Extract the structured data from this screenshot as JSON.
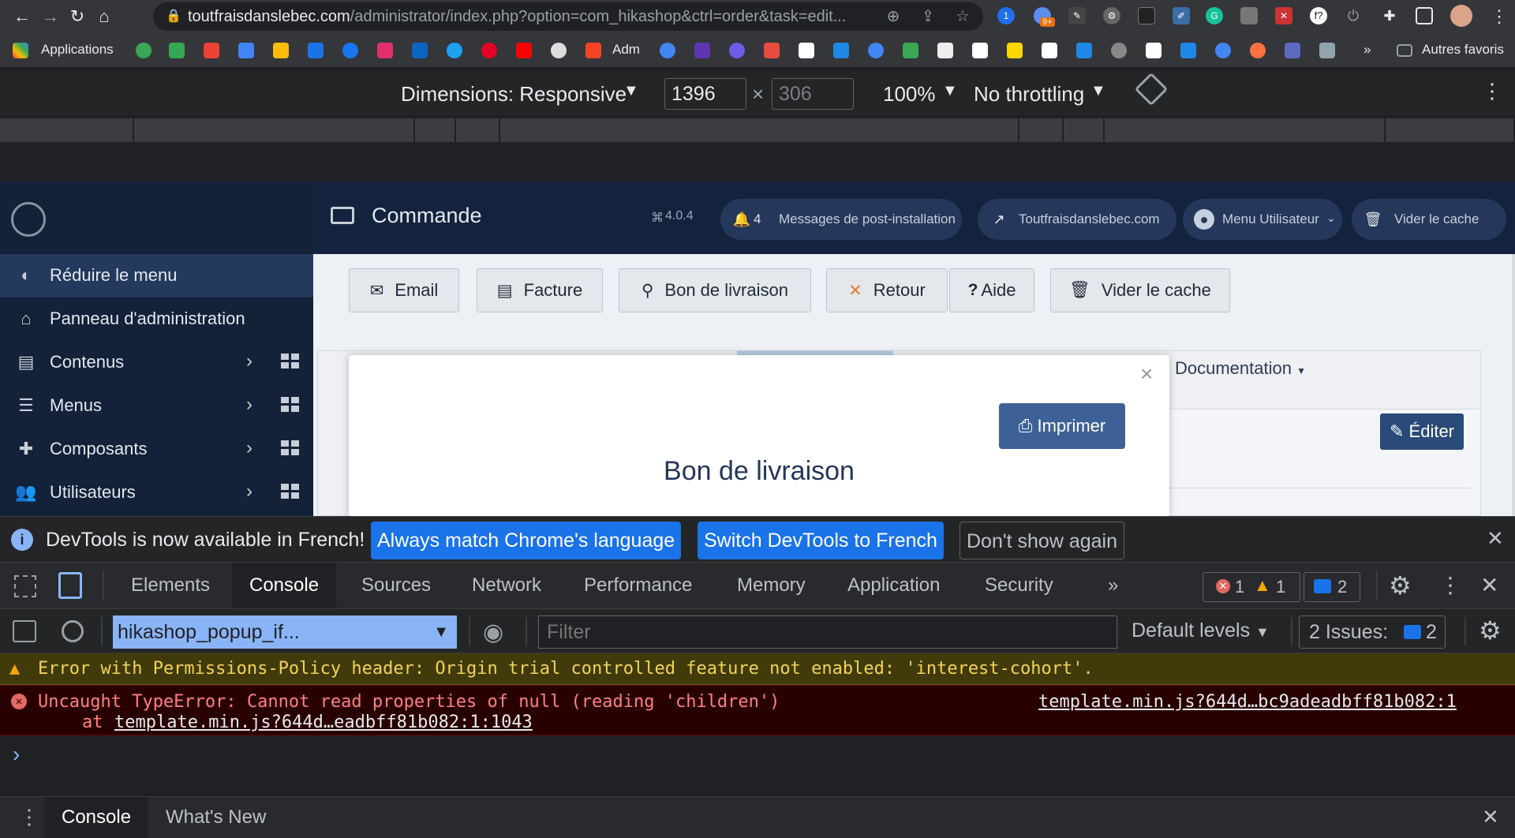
{
  "browser": {
    "url_host": "toutfraisdanslebec.com",
    "url_path": "/administrator/index.php?option=com_hikashop&ctrl=order&task=edit...",
    "bookmarks_apps": "Applications",
    "bookmark_adm": "Adm",
    "bookmarks_more": "»",
    "other_bookmarks": "Autres favoris",
    "ext_badge": "9+"
  },
  "device_toolbar": {
    "dimensions_label": "Dimensions: Responsive",
    "width": "1396",
    "height_placeholder": "306",
    "zoom": "100%",
    "throttling": "No throttling"
  },
  "site": {
    "page_title": "Commande",
    "version": "4.0.4",
    "notif_count": "4",
    "post_install": "Messages de post-installation",
    "site_name": "Toutfraisdanslebec.com",
    "user_menu": "Menu Utilisateur",
    "clear_cache_top": "Vider le cache",
    "sidebar": [
      {
        "label": "Réduire le menu",
        "icon": "toggle-icon",
        "active": true
      },
      {
        "label": "Panneau d'administration",
        "icon": "home-icon"
      },
      {
        "label": "Contenus",
        "icon": "file-icon",
        "sub": true
      },
      {
        "label": "Menus",
        "icon": "list-icon",
        "sub": true
      },
      {
        "label": "Composants",
        "icon": "puzzle-icon",
        "sub": true
      },
      {
        "label": "Utilisateurs",
        "icon": "users-icon",
        "sub": true
      }
    ],
    "toolbar": {
      "email": "Email",
      "invoice": "Facture",
      "delivery": "Bon de livraison",
      "back": "Retour",
      "help": "Aide",
      "clear_cache": "Vider le cache"
    },
    "documentation": "Documentation",
    "edit": "Éditer"
  },
  "modal": {
    "close": "×",
    "print_label": "Imprimer",
    "title": "Bon de livraison"
  },
  "devtools": {
    "notice_text": "DevTools is now available in French!",
    "btn_match": "Always match Chrome's language",
    "btn_switch": "Switch DevTools to French",
    "btn_dont": "Don't show again",
    "tabs": [
      "Elements",
      "Console",
      "Sources",
      "Network",
      "Performance",
      "Memory",
      "Application",
      "Security"
    ],
    "active_tab": "Console",
    "more_tabs": "»",
    "error_count": "1",
    "warning_count": "1",
    "message_count": "2",
    "context": "hikashop_popup_if...",
    "filter_placeholder": "Filter",
    "levels": "Default levels",
    "issues_label": "2 Issues:",
    "issues_count": "2",
    "warning_msg": "Error with Permissions-Policy header: Origin trial controlled feature not enabled: 'interest-cohort'.",
    "error_msg": "Uncaught TypeError: Cannot read properties of null (reading 'children')",
    "error_source": "template.min.js?644d…bc9adeadbff81b082:1",
    "error_at": "at",
    "error_stack": "template.min.js?644d…eadbff81b082:1:1043",
    "prompt": "›",
    "drawer_tabs": [
      "Console",
      "What's New"
    ]
  },
  "colors": {
    "sidebar_bg": "#132139",
    "topbar_bg": "#14233d",
    "print_btn": "#3d6196",
    "devtools_accent": "#1a73e8"
  }
}
